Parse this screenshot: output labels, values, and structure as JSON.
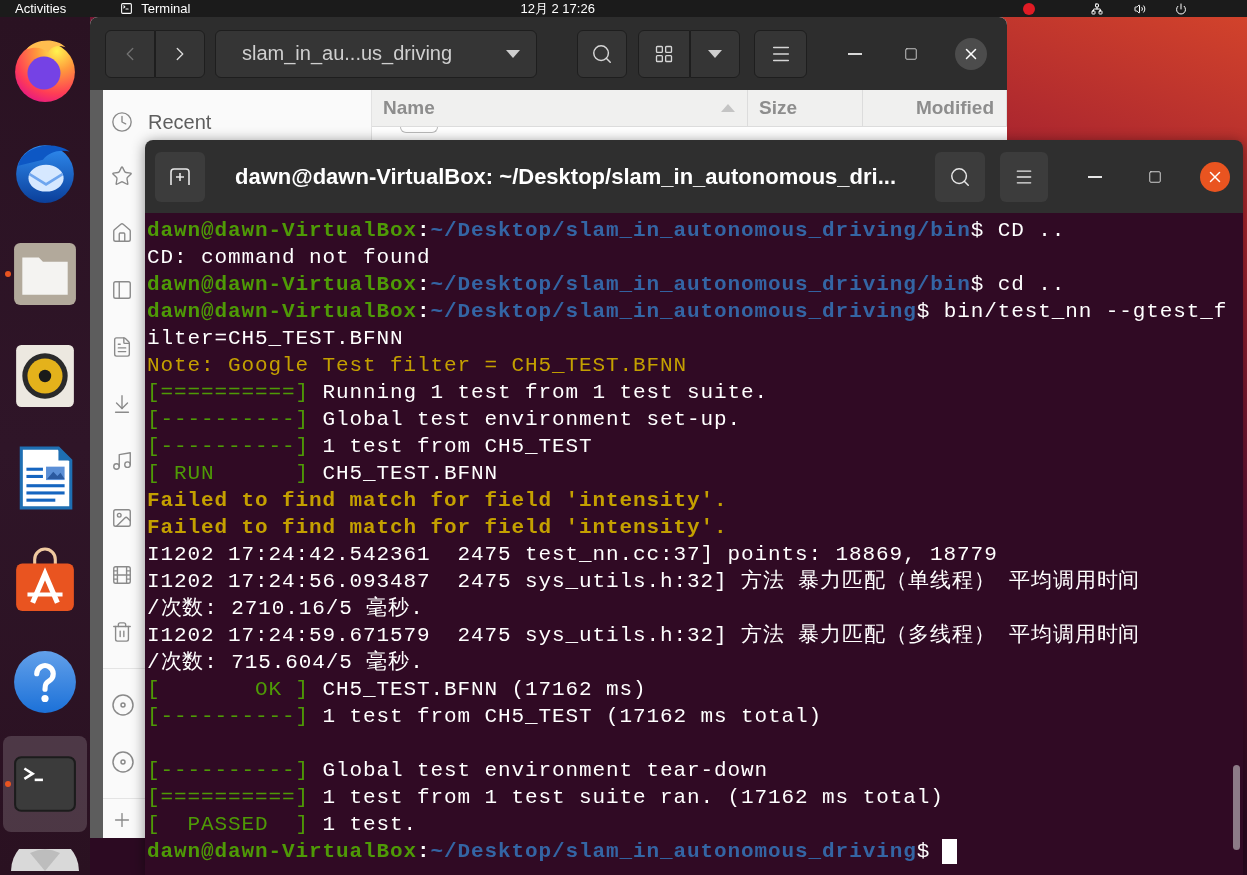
{
  "top_bar": {
    "activities": "Activities",
    "app_name": "Terminal",
    "clock": "12月 2 17:26"
  },
  "dock": {
    "items": [
      {
        "running": false,
        "active": false
      },
      {
        "running": false,
        "active": false
      },
      {
        "running": true,
        "active": false
      },
      {
        "running": false,
        "active": false
      },
      {
        "running": false,
        "active": false
      },
      {
        "running": false,
        "active": false
      },
      {
        "running": false,
        "active": false
      },
      {
        "running": true,
        "active": true
      },
      {
        "running": false,
        "active": false
      }
    ]
  },
  "file_manager": {
    "back": {
      "disabled": true
    },
    "forward": {
      "disabled": false
    },
    "path": "slam_in_au...us_driving",
    "sidebar": {
      "items": [
        {
          "label": "Recent"
        }
      ]
    },
    "columns": [
      {
        "label": "Name",
        "sorted": true
      },
      {
        "label": "Size",
        "sorted": false
      },
      {
        "label": "Modified",
        "sorted": false
      }
    ]
  },
  "terminal": {
    "title": "dawn@dawn-VirtualBox: ~/Desktop/slam_in_autonomous_dri...",
    "lines": [
      {
        "kind": "prompt",
        "user": "dawn@dawn-VirtualBox",
        "separator": ":",
        "path": "~/Desktop/slam_in_autonomous_driving/bin",
        "symbol": "$",
        "command": "CD ..",
        "cursor": false
      },
      {
        "kind": "output",
        "text": "CD: command not found"
      },
      {
        "kind": "prompt",
        "user": "dawn@dawn-VirtualBox",
        "separator": ":",
        "path": "~/Desktop/slam_in_autonomous_driving/bin",
        "symbol": "$",
        "command": "cd ..",
        "cursor": false
      },
      {
        "kind": "prompt",
        "user": "dawn@dawn-VirtualBox",
        "separator": ":",
        "path": "~/Desktop/slam_in_autonomous_driving",
        "symbol": "$",
        "command": "bin/test_nn --gtest_f",
        "cursor": false
      },
      {
        "kind": "output",
        "text": "ilter=CH5_TEST.BFNN"
      },
      {
        "kind": "note",
        "text": "Note: Google Test filter = CH5_TEST.BFNN"
      },
      {
        "kind": "gtest",
        "tag": "[==========]",
        "text": "Running 1 test from 1 test suite."
      },
      {
        "kind": "gtest",
        "tag": "[----------]",
        "text": "Global test environment set-up."
      },
      {
        "kind": "gtest",
        "tag": "[----------]",
        "text": "1 test from CH5_TEST"
      },
      {
        "kind": "gtest",
        "tag": "[ RUN      ]",
        "text": "CH5_TEST.BFNN"
      },
      {
        "kind": "warning",
        "text": "Failed to find match for field 'intensity'."
      },
      {
        "kind": "warning",
        "text": "Failed to find match for field 'intensity'."
      },
      {
        "kind": "output",
        "text": "I1202 17:24:42.542361  2475 test_nn.cc:37] points: 18869, 18779"
      },
      {
        "kind": "output",
        "text": "I1202 17:24:56.093487  2475 sys_utils.h:32] 方法 暴力匹配（单线程） 平均调用时间"
      },
      {
        "kind": "output",
        "text": "/次数: 2710.16/5 毫秒."
      },
      {
        "kind": "output",
        "text": "I1202 17:24:59.671579  2475 sys_utils.h:32] 方法 暴力匹配（多线程） 平均调用时间"
      },
      {
        "kind": "output",
        "text": "/次数: 715.604/5 毫秒."
      },
      {
        "kind": "gtest",
        "tag": "[       OK ]",
        "text": "CH5_TEST.BFNN (17162 ms)"
      },
      {
        "kind": "gtest",
        "tag": "[----------]",
        "text": "1 test from CH5_TEST (17162 ms total)"
      },
      {
        "kind": "blank"
      },
      {
        "kind": "gtest",
        "tag": "[----------]",
        "text": "Global test environment tear-down"
      },
      {
        "kind": "gtest",
        "tag": "[==========]",
        "text": "1 test from 1 test suite ran. (17162 ms total)"
      },
      {
        "kind": "gtest",
        "tag": "[  PASSED  ]",
        "text": "1 test."
      },
      {
        "kind": "prompt",
        "user": "dawn@dawn-VirtualBox",
        "separator": ":",
        "path": "~/Desktop/slam_in_autonomous_driving",
        "symbol": "$",
        "cursor": true
      }
    ]
  }
}
